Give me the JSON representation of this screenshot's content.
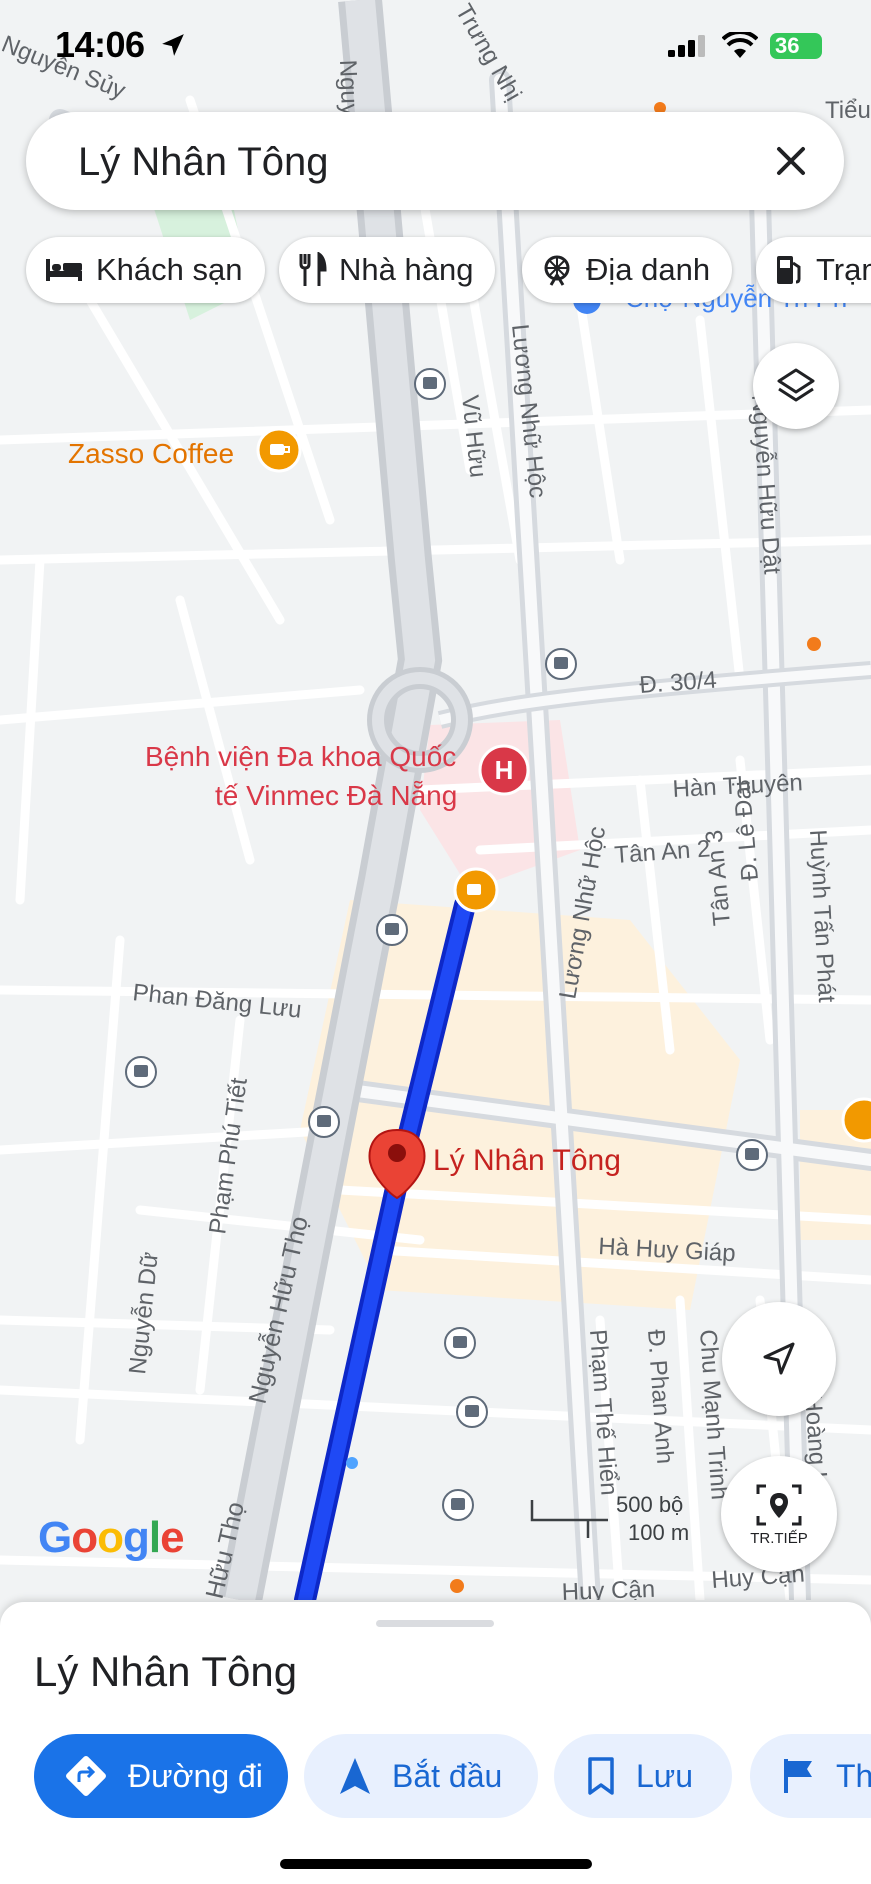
{
  "status": {
    "time": "14:06",
    "battery": "36"
  },
  "search": {
    "query": "Lý Nhân Tông"
  },
  "chips": [
    {
      "label": "Khách sạn",
      "icon": "bed-icon"
    },
    {
      "label": "Nhà hàng",
      "icon": "restaurant-icon"
    },
    {
      "label": "Địa danh",
      "icon": "landmark-icon"
    },
    {
      "label": "Trạm",
      "icon": "gas-station-icon"
    }
  ],
  "map": {
    "streets": {
      "nguyen_huu_top": "Nguyễn Hữu",
      "trung_nhi": "Trưng Nhị",
      "nguyen_suy": "Nguyễn Sủy",
      "tieu": "Tiểu",
      "vu_huu": "Vũ Hữu",
      "luong_nhu_hoc": "Lương Nhữ Hộc",
      "nguyen_huu_dat": "Nguyễn Hữu Dật",
      "d_30_4": "Đ. 30/4",
      "han_thuyen": "Hàn Thuyên",
      "tan_an_2": "Tân An 2",
      "d_le_dai": "Đ. Lê Đại",
      "tan_an_3": "Tân An 3",
      "huynh_tan_phat": "Huỳnh Tấn Phát",
      "phan_dang_luu": "Phan Đăng Lưu",
      "pham_phu_tiet": "Phạm Phú Tiết",
      "nguyen_du": "Nguyễn Dữ",
      "nguyen_huu_tho": "Nguyễn Hữu Thọ",
      "huu_tho": "Hữu Thọ",
      "ha_huy_giap": "Hà Huy Giáp",
      "pham_the_hien": "Phạm Thế Hiển",
      "d_phan_anh": "Đ. Phan Anh",
      "chu_manh_trinh": "Chu Mạnh Trinh",
      "huy_can": "Huy Cận",
      "huy_can_2": "Huy Cận",
      "cho_nguyen": "Chợ Nguyễn Tri Ph",
      "hoang_ham": "Hoàng Hâm"
    },
    "pois": {
      "zasso": "Zasso Coffee",
      "vinmec_1": "Bệnh viện Đa khoa Quốc",
      "vinmec_2": "tế Vinmec Đà Nẵng",
      "pin_label": "Lý Nhân Tông"
    },
    "scale": {
      "feet": "500 bộ",
      "meters": "100 m"
    },
    "logo": "Google",
    "next_button": "TR.TIẾP",
    "colors": {
      "route": "#1a3cf0",
      "pin": "#ea4335",
      "poi_orange": "#f29900",
      "hospital": "#d93848"
    }
  },
  "sheet": {
    "title": "Lý Nhân Tông",
    "buttons": [
      {
        "label": "Đường đi",
        "icon": "directions-icon"
      },
      {
        "label": "Bắt đầu",
        "icon": "navigation-arrow-icon"
      },
      {
        "label": "Lưu",
        "icon": "bookmark-icon"
      },
      {
        "label": "Th",
        "icon": "flag-icon"
      }
    ]
  }
}
